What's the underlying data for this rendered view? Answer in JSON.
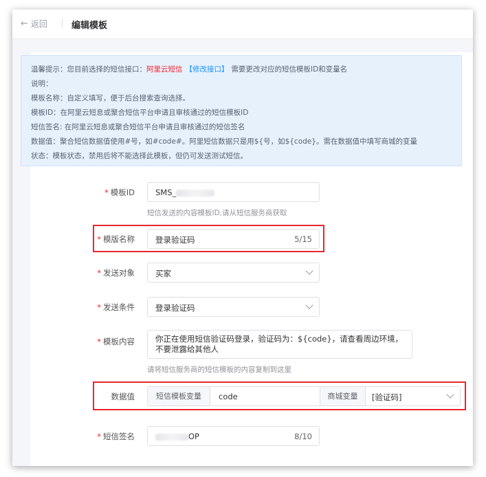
{
  "header": {
    "back_label": "返回",
    "title": "编辑模板"
  },
  "tips": {
    "line1_prefix": "温馨提示：您目前选择的短信接口：",
    "line1_provider": "阿里云短信",
    "line1_link": "【修改接口】",
    "line1_suffix": "需要更改对应的短信模板ID和变量名",
    "line2": "说明：",
    "line3": "模板名称：自定义填写，便于后台搜索查询选择。",
    "line4": "模板ID：在阿里云短息或聚合短信平台申请且审核通过的短信模板ID",
    "line5": "短信签名: 在阿里云短息或聚合短信平台申请且审核通过的短信签名",
    "line6": "数据值：聚合短信数据值使用#号，如#code#。阿里短信数据只是用${号，如${code}。需在数据值中填写商城的变量",
    "line7": "状态：模板状态，禁用后将不能选择此模板，但仍可发送测试短信。"
  },
  "form": {
    "template_id": {
      "label": "模板ID",
      "value": "SMS_",
      "hint": "短信发送的内容模板ID,请从短信服务商获取"
    },
    "template_name": {
      "label": "模版名称",
      "value": "登录验证码",
      "count": "5/15"
    },
    "send_target": {
      "label": "发送对象",
      "value": "买家"
    },
    "send_condition": {
      "label": "发送条件",
      "value": "登录验证码"
    },
    "template_content": {
      "label": "模板内容",
      "value": "你正在使用短信验证码登录，验证码为：${code}，请查看周边环境，不要泄露给其他人",
      "hint": "请将短信服务商的短信模板的内容复制到这里"
    },
    "data_value": {
      "label": "数据值",
      "sms_var_label": "短信模板变量",
      "sms_var_value": "code",
      "mall_var_label": "商城变量",
      "mall_var_value": "[验证码]"
    },
    "sms_signature": {
      "label": "短信签名",
      "value": "OP",
      "count": "8/10"
    }
  },
  "colors": {
    "highlight": "#e8262e",
    "required": "#f5222d",
    "link": "#1890ff",
    "tip_bg": "#e6f1fc"
  }
}
